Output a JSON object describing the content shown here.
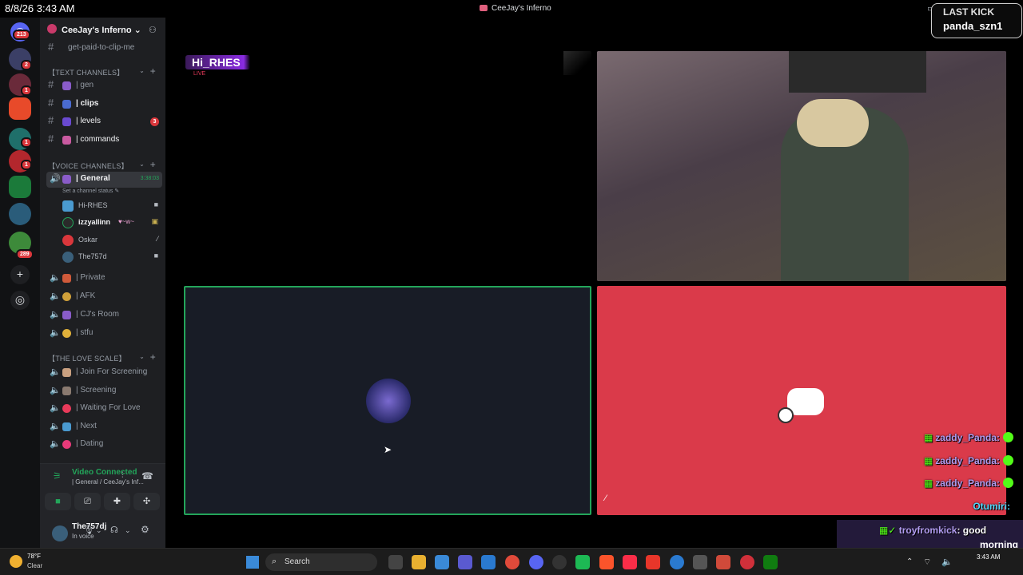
{
  "titlebar": {
    "clock": "8/8/26 3:43 AM",
    "window_title": "CeeJay's Inferno"
  },
  "rail": {
    "badges": [
      "213",
      "2",
      "1",
      "1",
      "1",
      "289"
    ]
  },
  "sidebar": {
    "guild_name": "CeeJay's Inferno",
    "top_channel": "get-paid-to-clip-me",
    "text_category": "【TEXT CHANNELS】",
    "text_channels": [
      {
        "label": "| gen"
      },
      {
        "label": "| clips"
      },
      {
        "label": "| levels",
        "badge": "3"
      },
      {
        "label": "| commands"
      }
    ],
    "voice_category": "【VOICE CHANNELS】",
    "general": {
      "label": "| General",
      "timer": "3:38:03",
      "status": "Set a channel status"
    },
    "voice_users": [
      "Hi-RHES",
      "izzyallinn",
      "Oskar",
      "The757d"
    ],
    "izzy_tag": "♥~w~",
    "voice_channels": [
      "| Private",
      "| AFK",
      "| CJ's Room",
      "| stfu"
    ],
    "love_category": "【THE LOVE SCALE】",
    "love_channels": [
      "| Join For Screening",
      "| Screening",
      "| Waiting For Love",
      "| Next",
      "| Dating"
    ]
  },
  "voice_panel": {
    "status": "Video Connected",
    "subtitle": "| General / CeeJay's Inf...",
    "user": "The757dj",
    "user_status": "In voice"
  },
  "stage": {
    "rhes_label": "Hi_RHES",
    "rhes_sublabel": "LIVE",
    "last_kick_title": "LAST KICK",
    "last_kick_name": "panda_szn1",
    "chat": [
      {
        "user": "zaddy_Panda:"
      },
      {
        "user": "zaddy_Panda:"
      },
      {
        "user": "zaddy_Panda:"
      }
    ],
    "chat_otumiri": "Otumiri:",
    "chat_troy_user": "troyfromkick",
    "chat_troy_msg": ": good",
    "chat_morning": "morning"
  },
  "taskbar": {
    "weather_temp": "78°F",
    "weather_desc": "Clear",
    "search": "Search",
    "time": "3:43 AM"
  },
  "colors": {
    "discord_green": "#23a55a",
    "discord_red": "#da373c",
    "oskar_tile": "#da3a4a",
    "kick_green": "#53fc18"
  }
}
